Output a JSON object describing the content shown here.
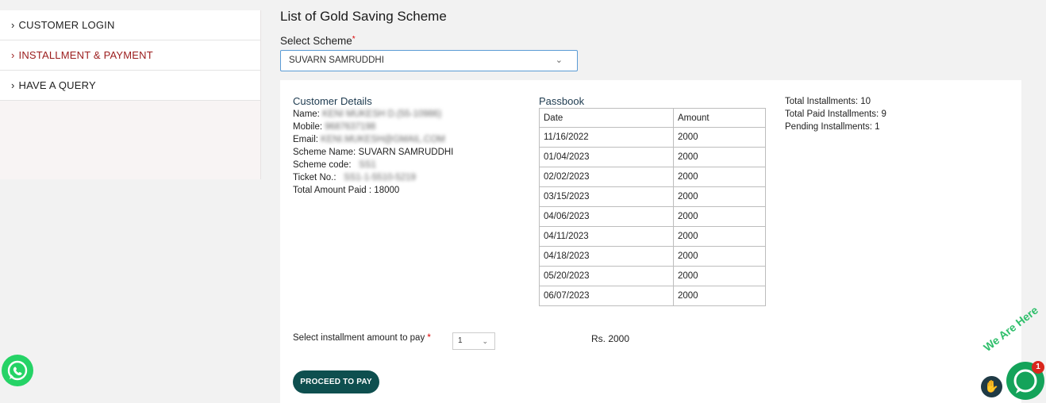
{
  "sidebar": {
    "items": [
      {
        "label": "CUSTOMER LOGIN"
      },
      {
        "label": "INSTALLMENT & PAYMENT"
      },
      {
        "label": "HAVE A QUERY"
      }
    ]
  },
  "page": {
    "title": "List of Gold Saving Scheme",
    "select_label": "Select Scheme",
    "selected_scheme": "SUVARN SAMRUDDHI"
  },
  "customer": {
    "heading": "Customer Details",
    "name_label": "Name:",
    "name_value": "KENI MUKESH D.(55-10986)",
    "mobile_label": "Mobile:",
    "mobile_value": "9687637198",
    "email_label": "Email:",
    "email_value": "KENI.MUKESH@GMAIL.COM",
    "scheme_name_label": "Scheme Name:",
    "scheme_name_value": "SUVARN SAMRUDDHI",
    "scheme_code_label": "Scheme code:",
    "scheme_code_value": "SS1",
    "ticket_label": "Ticket No.:",
    "ticket_value": "SS1-1-5510-5219",
    "total_paid_label": "Total Amount Paid :",
    "total_paid_value": "18000"
  },
  "passbook": {
    "title": "Passbook",
    "columns": [
      "Date",
      "Amount"
    ],
    "rows": [
      {
        "date": "11/16/2022",
        "amount": "2000"
      },
      {
        "date": "01/04/2023",
        "amount": "2000"
      },
      {
        "date": "02/02/2023",
        "amount": "2000"
      },
      {
        "date": "03/15/2023",
        "amount": "2000"
      },
      {
        "date": "04/06/2023",
        "amount": "2000"
      },
      {
        "date": "04/11/2023",
        "amount": "2000"
      },
      {
        "date": "04/18/2023",
        "amount": "2000"
      },
      {
        "date": "05/20/2023",
        "amount": "2000"
      },
      {
        "date": "06/07/2023",
        "amount": "2000"
      }
    ]
  },
  "totals": {
    "total_installments": "Total Installments: 10",
    "total_paid_installments": "Total Paid Installments: 9",
    "pending_installments": "Pending Installments: 1"
  },
  "payment": {
    "select_label": "Select installment amount to pay",
    "selected_count": "1",
    "amount_text": "Rs. 2000",
    "button_label": "PROCEED TO PAY"
  },
  "chat": {
    "badge_count": "1",
    "here_text": "We Are Here"
  },
  "icons": {
    "whatsapp": "whatsapp-icon",
    "chat": "chat-icon",
    "wave": "waving-hand-icon",
    "chevron": "chevron-right-icon",
    "dropdown": "chevron-down-icon"
  },
  "colors": {
    "active_link": "#9b1c1c",
    "button": "#0e4f4f",
    "whatsapp": "#25d366",
    "chat": "#14a35a",
    "badge": "#d9261c"
  }
}
